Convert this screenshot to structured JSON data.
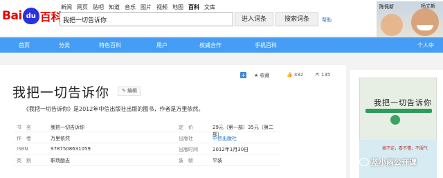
{
  "logo": {
    "bai": "Bai",
    "paw": "du",
    "baike": "百科"
  },
  "top_nav": [
    "新闻",
    "网页",
    "贴吧",
    "知道",
    "音乐",
    "图片",
    "视频",
    "地图",
    "百科",
    "文库"
  ],
  "top_nav_active": "百科",
  "search": {
    "value": "我把一切告诉你",
    "enter_label": "进入词条",
    "search_label": "搜索词条",
    "help": "帮助"
  },
  "avatar": {
    "name1": "陈佩斯",
    "name2": "杨立新"
  },
  "main_nav": [
    "首页",
    "分类",
    "特色百科",
    "用户",
    "权威合作",
    "手机百科",
    "个人中"
  ],
  "entry": {
    "title": "我把一切告诉你",
    "edit_label": "编辑",
    "actions": {
      "collect": "收藏",
      "likes": "332",
      "shares": "135"
    },
    "summary": "《我把一切告诉你》是2012年中信出版社出版的图书，作者是万里依然。",
    "info_rows": [
      {
        "l1": "书　名",
        "v1": "我把一切告诉你",
        "l2": "定　价",
        "v2": "29元（第一部）35元（第二部）",
        "link": false
      },
      {
        "l1": "作　者",
        "v1": "万里依然",
        "l2": "出版社",
        "v2": "中信出版社",
        "link": true
      },
      {
        "l1": "ISBN",
        "v1": "9787508631059",
        "l2": "出版时间",
        "v2": "2012年1月30日",
        "link": false
      },
      {
        "l1": "类　别",
        "v1": "职场励志",
        "l2": "装　帧",
        "v2": "平装",
        "link": false
      }
    ]
  },
  "sidebar": {
    "side_label": "",
    "book_title": "我把一切告诉你",
    "bottom_text": "搞不定，看不懂，不服气",
    "watermark": "蓝小雨公开课"
  },
  "colors": {
    "brand_red": "#e10601",
    "brand_blue": "#2932e1",
    "nav_blue": "#459df5",
    "link_blue": "#136ec2"
  }
}
